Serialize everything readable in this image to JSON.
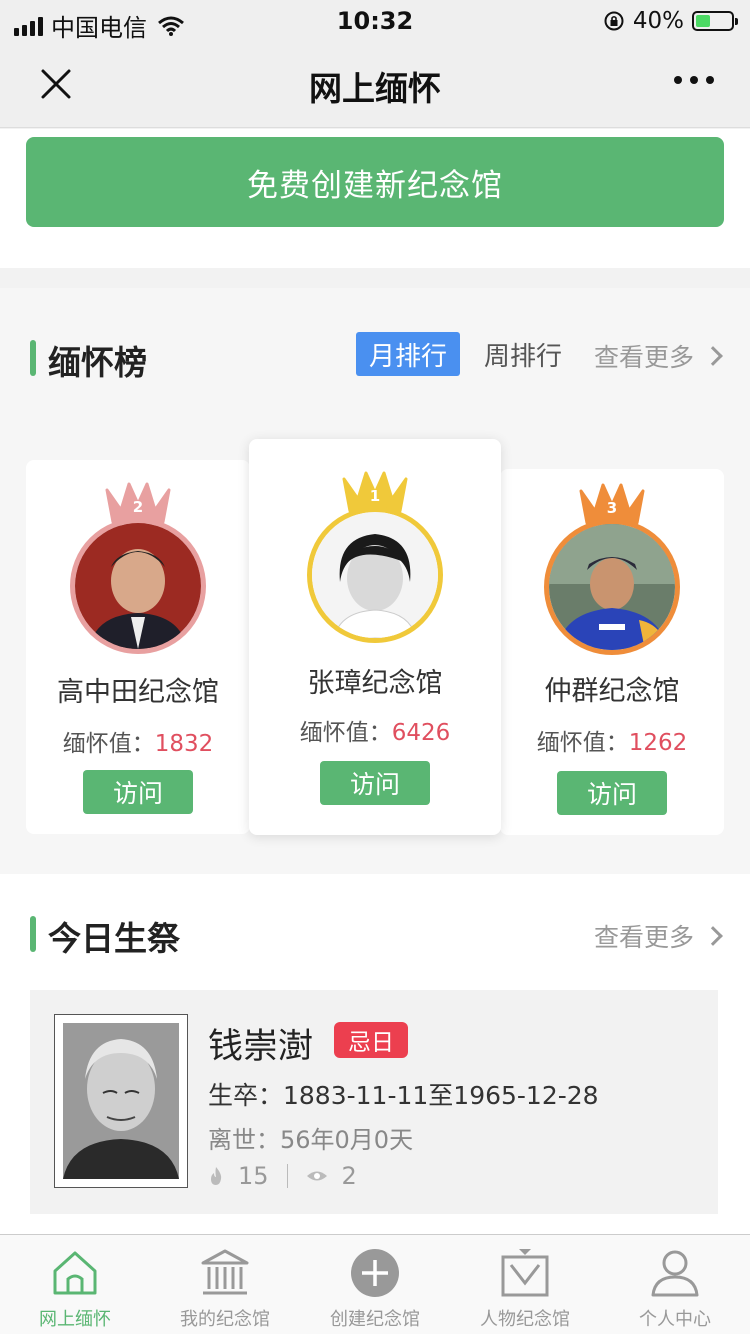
{
  "status_bar": {
    "carrier": "中国电信",
    "time": "10:32",
    "battery": "40%",
    "battery_level": 0.4
  },
  "nav": {
    "title": "网上缅怀"
  },
  "create": {
    "label": "免费创建新纪念馆"
  },
  "ranking": {
    "title": "缅怀榜",
    "tab_month": "月排行",
    "tab_week": "周排行",
    "more": "查看更多",
    "score_label": "缅怀值：",
    "visit_label": "访问",
    "items": [
      {
        "rank": "2",
        "name": "高中田纪念馆",
        "score": "1832",
        "crown_color": "#e8a0a0"
      },
      {
        "rank": "1",
        "name": "张璋纪念馆",
        "score": "6426",
        "crown_color": "#f0c93a"
      },
      {
        "rank": "3",
        "name": "仲群纪念馆",
        "score": "1262",
        "crown_color": "#ef8d3a"
      }
    ]
  },
  "today": {
    "title": "今日生祭",
    "more": "查看更多",
    "person": {
      "name": "钱崇澍",
      "badge": "忌日",
      "life": "生卒：1883-11-11至1965-12-28",
      "gone": "离世：56年0月0天",
      "flowers": "15",
      "views": "2"
    }
  },
  "tabbar": {
    "items": [
      {
        "label": "网上缅怀",
        "icon": "home-icon",
        "active": true
      },
      {
        "label": "我的纪念馆",
        "icon": "hall-icon",
        "active": false
      },
      {
        "label": "创建纪念馆",
        "icon": "plus-icon",
        "active": false
      },
      {
        "label": "人物纪念馆",
        "icon": "person-hall-icon",
        "active": false
      },
      {
        "label": "个人中心",
        "icon": "user-icon",
        "active": false
      }
    ]
  },
  "colors": {
    "accent_green": "#5ab673",
    "tab_blue": "#4a90f0",
    "score_red": "#e04f5f",
    "badge_red": "#ec3f4f"
  }
}
